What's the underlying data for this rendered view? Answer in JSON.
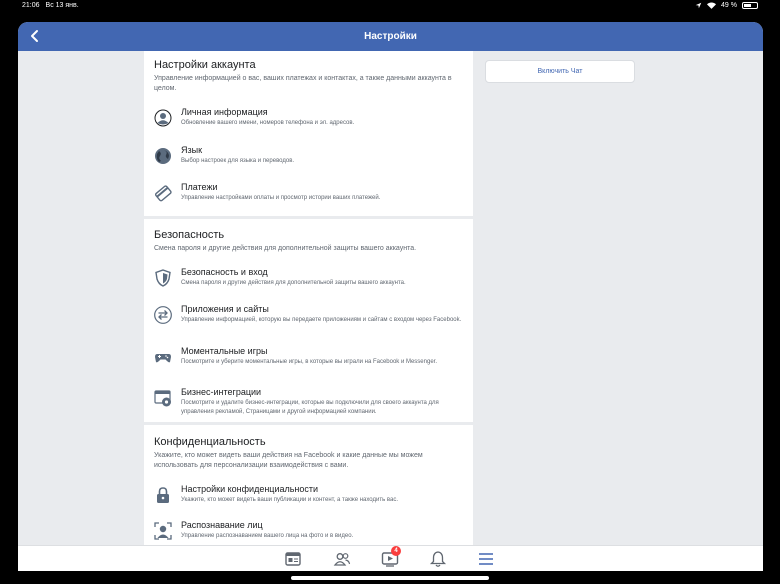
{
  "status_bar": {
    "time": "21:06",
    "date": "Вс 13 янв.",
    "battery_text": "49 %",
    "battery_level": 0.49
  },
  "navbar": {
    "title": "Настройки",
    "back_icon": "chevron-left-icon"
  },
  "chat_button": {
    "label": "Включить Чат"
  },
  "sections": [
    {
      "title": "Настройки аккаунта",
      "description": "Управление информацией о вас, ваших платежах и контактах, а также данными аккаунта в целом.",
      "items": [
        {
          "icon": "person-icon",
          "title": "Личная информация",
          "description": "Обновление вашего имени, номеров телефона и эл. адресов."
        },
        {
          "icon": "globe-icon",
          "title": "Язык",
          "description": "Выбор настроек для языка и переводов."
        },
        {
          "icon": "card-icon",
          "title": "Платежи",
          "description": "Управление настройками оплаты и просмотр истории ваших платежей."
        }
      ]
    },
    {
      "title": "Безопасность",
      "description": "Смена пароля и другие действия для дополнительной защиты вашего аккаунта.",
      "items": [
        {
          "icon": "shield-icon",
          "title": "Безопасность и вход",
          "description": "Смена пароля и другие действия для дополнительной защиты вашего аккаунта."
        },
        {
          "icon": "arrows-icon",
          "title": "Приложения и сайты",
          "description": "Управление информацией, которую вы передаете приложениям и сайтам с входом через Facebook."
        },
        {
          "icon": "gamepad-icon",
          "title": "Моментальные игры",
          "description": "Посмотрите и уберите моментальные игры, в которые вы играли на Facebook и Messenger."
        },
        {
          "icon": "business-gear-icon",
          "title": "Бизнес-интеграции",
          "description": "Посмотрите и удалите бизнес-интеграции, которые вы подключили для своего аккаунта для управления рекламой, Страницами и другой информацией компании."
        }
      ]
    },
    {
      "title": "Конфиденциальность",
      "description": "Укажите, кто может видеть ваши действия на Facebook и какие данные мы можем использовать для персонализации взаимодействия с вами.",
      "items": [
        {
          "icon": "lock-icon",
          "title": "Настройки конфиденциальности",
          "description": "Укажите, кто может видеть ваши публикации и контент, а также находить вас."
        },
        {
          "icon": "face-recognition-icon",
          "title": "Распознавание лиц",
          "description": "Управление распознаванием вашего лица на фото и в видео."
        }
      ]
    }
  ],
  "tab_bar": {
    "tabs": [
      {
        "icon": "news-feed-icon"
      },
      {
        "icon": "friends-icon"
      },
      {
        "icon": "watch-icon",
        "badge": "4"
      },
      {
        "icon": "bell-icon"
      },
      {
        "icon": "menu-icon"
      }
    ]
  },
  "colors": {
    "brand": "#4267b2",
    "badge": "#fa3e3e",
    "background": "#e9ebee"
  }
}
